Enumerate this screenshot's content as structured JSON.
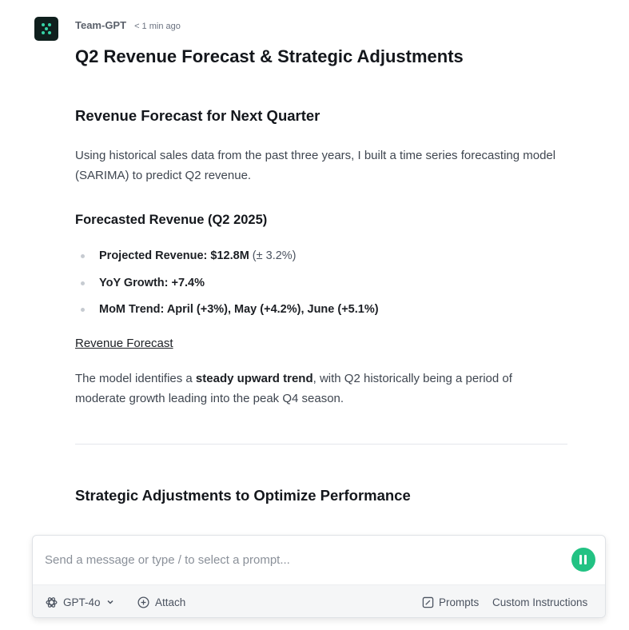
{
  "message": {
    "author": "Team-GPT",
    "timestamp": "< 1 min ago",
    "avatar_icon": "team-gpt-logo-icon",
    "title": "Q2 Revenue Forecast & Strategic Adjustments",
    "section1": {
      "heading": "Revenue Forecast for Next Quarter",
      "intro": "Using historical sales data from the past three years, I built a time series forecasting model (SARIMA) to predict Q2 revenue.",
      "subheading": "Forecasted Revenue (Q2 2025)",
      "bullets": [
        {
          "bold": "Projected Revenue: $12.8M",
          "rest": " (± 3.2%)"
        },
        {
          "bold": "YoY Growth: +7.4%",
          "rest": ""
        },
        {
          "bold": "MoM Trend: April (+3%), May (+4.2%), June (+5.1%)",
          "rest": ""
        }
      ],
      "link_text": "Revenue Forecast",
      "summary_before": "The model identifies a ",
      "summary_bold": "steady upward trend",
      "summary_after": ", with Q2 historically being a period of moderate growth leading into the peak Q4 season."
    },
    "section2": {
      "heading": "Strategic Adjustments to Optimize Performance"
    }
  },
  "composer": {
    "placeholder": "Send a message or type / to select a prompt...",
    "send_icon": "pause-icon",
    "send_color": "#22c283",
    "model_label": "GPT-4o",
    "attach_label": "Attach",
    "prompts_label": "Prompts",
    "custom_instructions_label": "Custom Instructions"
  }
}
